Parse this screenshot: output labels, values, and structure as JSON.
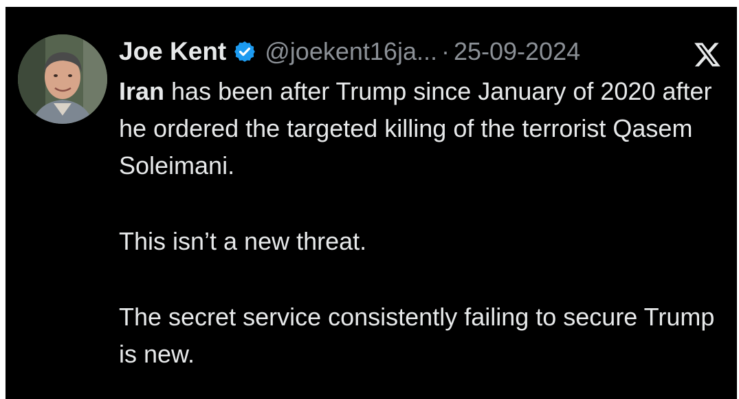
{
  "tweet": {
    "author_name": "Joe Kent",
    "handle": "@joekent16ja...",
    "separator": "·",
    "date": "25-09-2024",
    "first_word": "Iran",
    "paragraph_1_rest": " has been after Trump since January of 2020 after he ordered the targeted killing of the terrorist Qasem Soleimani.",
    "paragraph_2": "This isn’t a new threat.",
    "paragraph_3": "The secret service consistently failing to secure Trump is new."
  },
  "icons": {
    "verified": "verified-badge-icon",
    "platform": "x-logo-icon",
    "avatar": "profile-photo"
  },
  "colors": {
    "background": "#000000",
    "text": "#e7e9ea",
    "muted": "#8b9096",
    "verified_blue": "#1d9bf0"
  }
}
